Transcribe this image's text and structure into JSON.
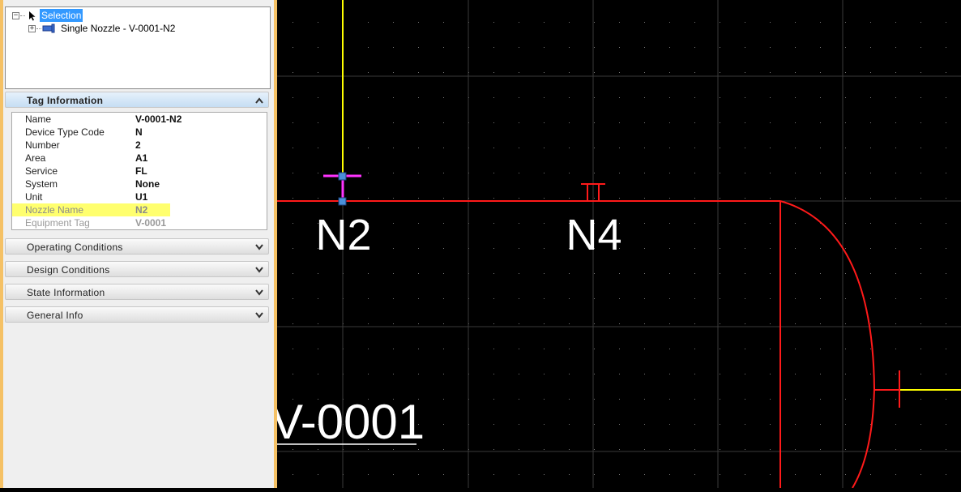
{
  "tree": {
    "root_label": "Selection",
    "child_label": "Single Nozzle - V-0001-N2"
  },
  "tag_info": {
    "title": "Tag Information",
    "rows": [
      {
        "key": "Name",
        "value": "V-0001-N2"
      },
      {
        "key": "Device Type Code",
        "value": "N"
      },
      {
        "key": "Number",
        "value": "2"
      },
      {
        "key": "Area",
        "value": "A1"
      },
      {
        "key": "Service",
        "value": "FL"
      },
      {
        "key": "System",
        "value": "None"
      },
      {
        "key": "Unit",
        "value": "U1"
      },
      {
        "key": "Nozzle Name",
        "value": "N2"
      },
      {
        "key": "Equipment Tag",
        "value": "V-0001"
      }
    ]
  },
  "panels": {
    "operating": "Operating Conditions",
    "design": "Design Conditions",
    "state": "State Information",
    "general": "General Info"
  },
  "drawing": {
    "nozzle_label_1": "N2",
    "nozzle_label_2": "N4",
    "equipment_label": "V-0001"
  },
  "colors": {
    "vessel_line": "#ff1a1a",
    "pipe_line": "#ffff00",
    "grip": "#ff33ff",
    "highlight": "#ffff6e",
    "panel_accent": "#f5c165"
  }
}
